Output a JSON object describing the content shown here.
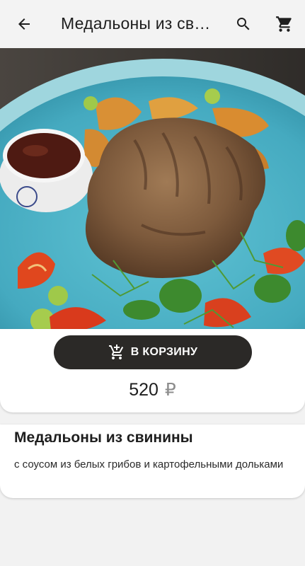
{
  "header": {
    "title": "Медальоны из свинины",
    "back_icon": "arrow-back-icon",
    "search_icon": "search-icon",
    "cart_icon": "shopping-cart-icon"
  },
  "product": {
    "image_alt": "grilled pork medallion on blue plate",
    "name": "Медальоны из свинины",
    "description": "с соусом из белых грибов и картофельными дольками",
    "price": "520",
    "currency": "₽"
  },
  "actions": {
    "add_to_cart_label": "В КОРЗИНУ",
    "add_to_cart_icon": "add-shopping-cart-icon"
  },
  "colors": {
    "button_bg": "#2b2927",
    "background": "#f2f2f2",
    "plate": "#4cb3c7"
  }
}
